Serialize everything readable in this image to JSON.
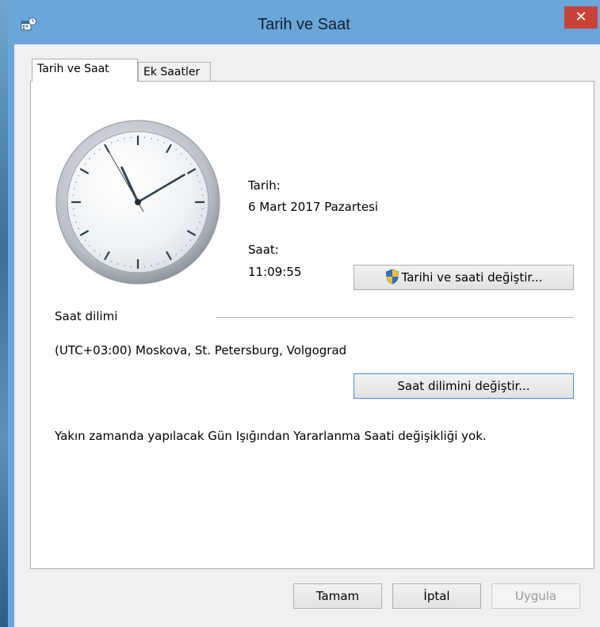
{
  "window": {
    "title": "Tarih ve Saat",
    "close_glyph": "✕",
    "icon": "date-time-app-icon"
  },
  "tabs": [
    {
      "label": "Tarih ve Saat",
      "active": true
    },
    {
      "label": "Ek Saatler",
      "active": false
    }
  ],
  "clock": {
    "hour": 11,
    "minute": 9,
    "second": 55
  },
  "date": {
    "label": "Tarih:",
    "value": "6 Mart 2017 Pazartesi"
  },
  "time": {
    "label": "Saat:",
    "value": "11:09:55"
  },
  "buttons": {
    "change_date_time": "Tarihi ve saati değiştir...",
    "change_timezone": "Saat dilimini değiştir...",
    "ok": "Tamam",
    "cancel": "İptal",
    "apply": "Uygula"
  },
  "timezone": {
    "section_label": "Saat dilimi",
    "value": "(UTC+03:00) Moskova, St. Petersburg, Volgograd"
  },
  "dst_notice": "Yakın zamanda yapılacak Gün Işığından Yararlanma Saati değişikliği yok.",
  "colors": {
    "titlebar": "#6aa6d9",
    "close_button": "#c9423a",
    "dialog_bg": "#f0f0f0",
    "shield_blue": "#2f6fc9",
    "shield_yellow": "#f2c12e"
  }
}
